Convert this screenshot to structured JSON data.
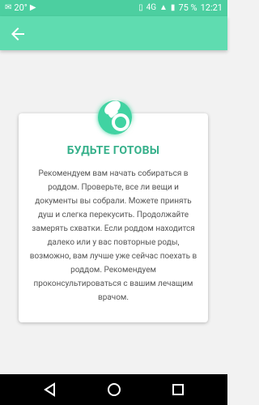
{
  "status": {
    "temp": "20°",
    "network": "4G",
    "battery": "75 %",
    "time": "12:21"
  },
  "icons": {
    "back": "arrow-left-icon",
    "main": "pacifier-icon"
  },
  "card": {
    "title": "БУДЬТЕ ГОТОВЫ",
    "body": "Рекомендуем вам начать собираться в роддом. Проверьте, все ли вещи и документы вы собрали. Можете принять душ и слегка перекусить. Продолжайте замерять схватки. Если роддом находится далеко или у вас повторные роды, возможно, вам лучше уже сейчас поехать в роддом. Рекомендуем проконсультироваться с вашим лечащим врачом."
  },
  "colors": {
    "appbar": "#5fdcb0",
    "accent": "#35b08a"
  }
}
